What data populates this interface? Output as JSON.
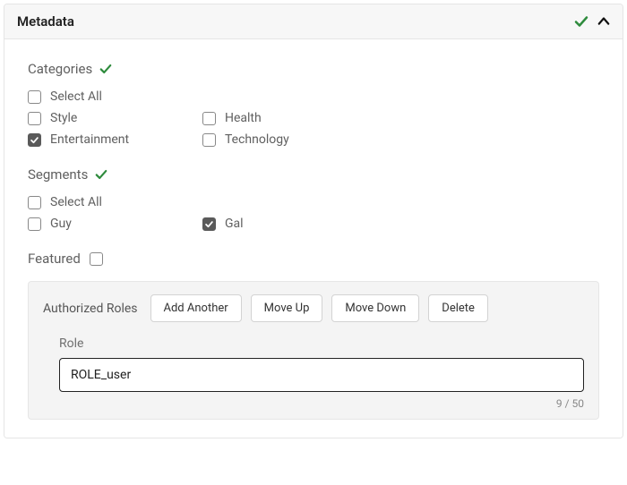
{
  "header": {
    "title": "Metadata"
  },
  "categories": {
    "title": "Categories",
    "selectAll": {
      "label": "Select All",
      "checked": false
    },
    "items": [
      {
        "label": "Style",
        "checked": false
      },
      {
        "label": "Health",
        "checked": false
      },
      {
        "label": "Entertainment",
        "checked": true
      },
      {
        "label": "Technology",
        "checked": false
      }
    ]
  },
  "segments": {
    "title": "Segments",
    "selectAll": {
      "label": "Select All",
      "checked": false
    },
    "items": [
      {
        "label": "Guy",
        "checked": false
      },
      {
        "label": "Gal",
        "checked": true
      }
    ]
  },
  "featured": {
    "label": "Featured",
    "checked": false
  },
  "roles": {
    "title": "Authorized Roles",
    "buttons": {
      "add": "Add Another",
      "up": "Move Up",
      "down": "Move Down",
      "delete": "Delete"
    },
    "field": {
      "label": "Role",
      "value": "ROLE_user",
      "count": "9 / 50"
    }
  },
  "colors": {
    "green": "#2e8b3d"
  }
}
